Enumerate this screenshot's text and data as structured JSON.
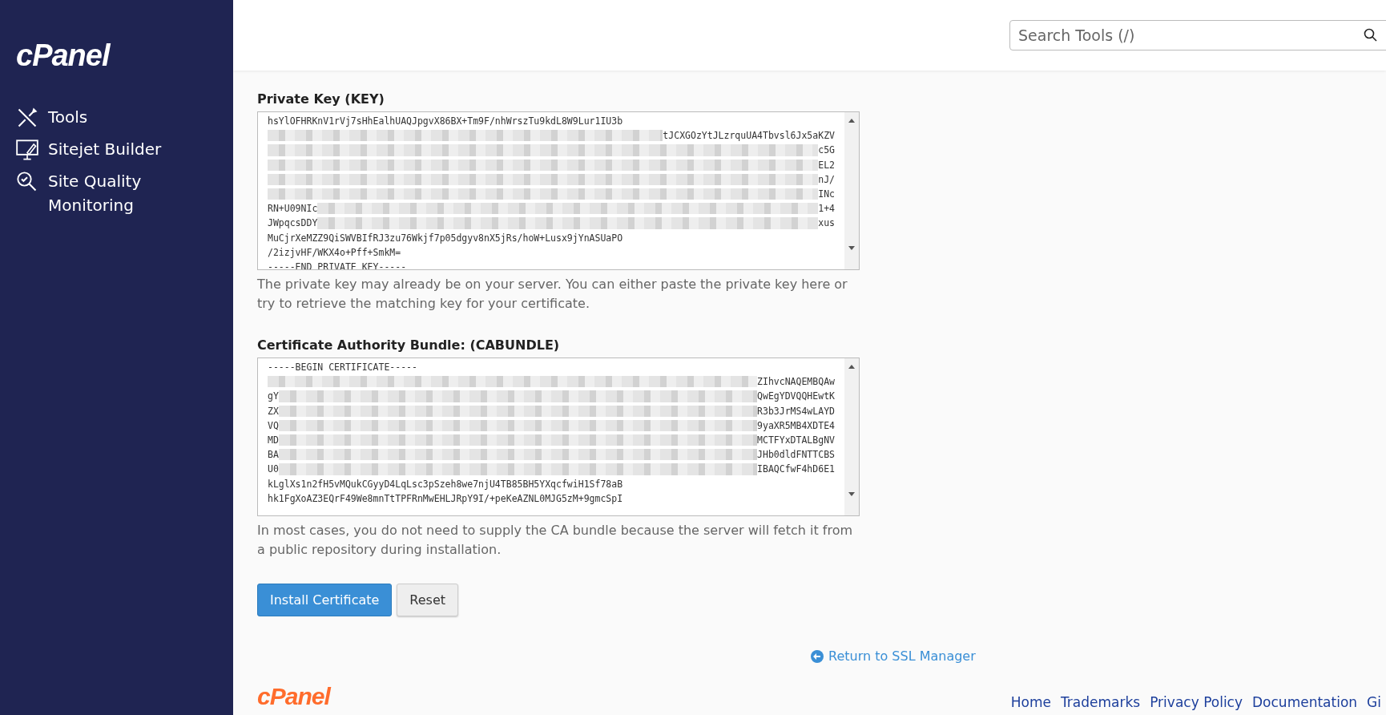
{
  "sidebar": {
    "logo": "cPanel",
    "items": [
      {
        "label": "Tools"
      },
      {
        "label": "Sitejet Builder"
      },
      {
        "label": "Site Quality Monitoring"
      }
    ]
  },
  "search": {
    "placeholder": "Search Tools (/)"
  },
  "fields": [
    {
      "label": "Private Key (KEY)",
      "lines": [
        {
          "kind": "plain",
          "text": "hsYlOFHRKnV1rVj7sHhEalhUAQJpgvX86BX+Tm9F/nhWrszTu9kdL8W9Lur1IU3b"
        },
        {
          "kind": "redacted",
          "right": "tJCXGOzYtJLzrquUA4Tbvsl6Jx5aKZV"
        },
        {
          "kind": "redacted",
          "right": "c5G"
        },
        {
          "kind": "redacted",
          "right": "EL2"
        },
        {
          "kind": "redacted",
          "right": "nJ/"
        },
        {
          "kind": "redacted",
          "right": "INc"
        },
        {
          "kind": "redacted",
          "left": "RN+U09NIc",
          "right": "1+4"
        },
        {
          "kind": "redacted",
          "left": "JWpqcsDDY",
          "right": "xus"
        },
        {
          "kind": "plain",
          "text": "MuCjrXeMZZ9QiSWVBIfRJ3zu76Wkjf7p05dgyv8nX5jRs/hoW+Lusx9jYnASUaPO"
        },
        {
          "kind": "plain",
          "text": "/2izjvHF/WKX4o+Pff+SmkM="
        },
        {
          "kind": "plain",
          "text": "-----END PRIVATE KEY-----"
        }
      ],
      "help": "The private key may already be on your server. You can either paste the private key here or try to retrieve the matching key for your certificate."
    },
    {
      "label": "Certificate Authority Bundle: (CABUNDLE)",
      "lines": [
        {
          "kind": "plain",
          "text": "-----BEGIN CERTIFICATE-----"
        },
        {
          "kind": "redacted",
          "right": "ZIhvcNAQEMBQAw"
        },
        {
          "kind": "redacted",
          "left": "gY",
          "right": "QwEgYDVQQHEwtK"
        },
        {
          "kind": "redacted",
          "left": "ZX",
          "right": "R3b3JrMS4wLAYD"
        },
        {
          "kind": "redacted",
          "left": "VQ",
          "right": "9yaXR5MB4XDTE4"
        },
        {
          "kind": "redacted",
          "left": "MD",
          "right": "MCTFYxDTALBgNV"
        },
        {
          "kind": "redacted",
          "left": "BA",
          "right": "JHb0dldFNTTCBS"
        },
        {
          "kind": "redacted",
          "left": "U0",
          "right": "IBAQCfwF4hD6E1"
        },
        {
          "kind": "plain",
          "text": "kLglXs1n2fH5vMQukCGyyD4LqLsc3pSzeh8we7njU4TB85BH5YXqcfwiH1Sf78aB"
        },
        {
          "kind": "plain",
          "text": "hk1FgXoAZ3EQrF49We8mnTtTPFRnMwEHLJRpY9I/+peKeAZNL0MJG5zM+9gmcSpI"
        }
      ],
      "help": "In most cases, you do not need to supply the CA bundle because the server will fetch it from a public repository during installation."
    }
  ],
  "buttons": [
    {
      "label": "Install Certificate",
      "kind": "primary"
    },
    {
      "label": "Reset",
      "kind": "secondary"
    }
  ],
  "return_link": "Return to SSL Manager",
  "footer": {
    "logo": "cPanel",
    "links": [
      "Home",
      "Trademarks",
      "Privacy Policy",
      "Documentation",
      "Gi"
    ]
  }
}
